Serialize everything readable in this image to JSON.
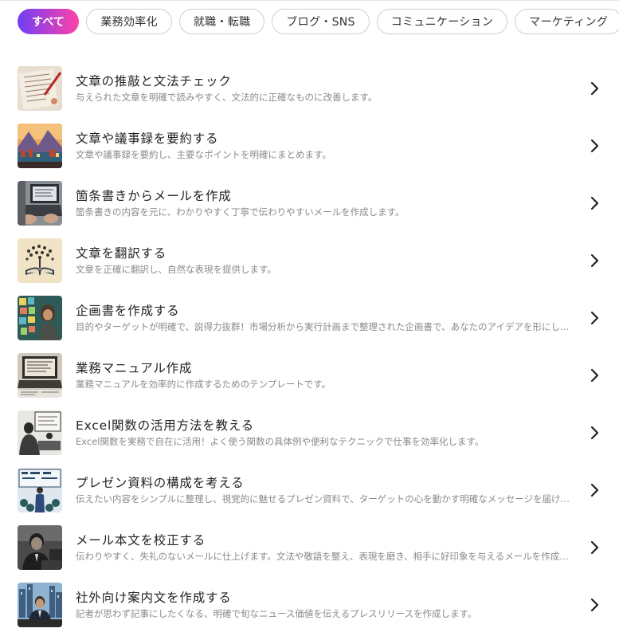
{
  "filters": [
    {
      "label": "すべて",
      "active": true
    },
    {
      "label": "業務効率化",
      "active": false
    },
    {
      "label": "就職・転職",
      "active": false
    },
    {
      "label": "ブログ・SNS",
      "active": false
    },
    {
      "label": "コミュニケーション",
      "active": false
    },
    {
      "label": "マーケティング",
      "active": false
    }
  ],
  "items": [
    {
      "title": "文章の推敲と文法チェック",
      "description": "与えられた文章を明確で読みやすく、文法的に正確なものに改善します。",
      "thumb": "pen-paper"
    },
    {
      "title": "文章や議事録を要約する",
      "description": "文章や議事録を要約し、主要なポイントを明確にまとめます。",
      "thumb": "landscape-town"
    },
    {
      "title": "箇条書きからメールを作成",
      "description": "箇条書きの内容を元に、わかりやすく丁寧で伝わりやすいメールを作成します。",
      "thumb": "laptop-hands"
    },
    {
      "title": "文章を翻訳する",
      "description": "文章を正確に翻訳し、自然な表現を提供します。",
      "thumb": "book-tree"
    },
    {
      "title": "企画書を作成する",
      "description": "目的やターゲットが明確で、説得力抜群！市場分析から実行計画まで整理された企画書で、あなたのアイデアを形にします。",
      "thumb": "notes-wall"
    },
    {
      "title": "業務マニュアル作成",
      "description": "業務マニュアルを効率的に作成するためのテンプレートです。",
      "thumb": "laptop-desk"
    },
    {
      "title": "Excel関数の活用方法を教える",
      "description": "Excel関数を実務で自在に活用！よく使う関数の具体例や便利なテクニックで仕事を効率化します。",
      "thumb": "classroom"
    },
    {
      "title": "プレゼン資料の構成を考える",
      "description": "伝えたい内容をシンプルに整理し、視覚的に魅せるプレゼン資料で、ターゲットの心を動かす明確なメッセージを届けます。",
      "thumb": "presentation"
    },
    {
      "title": "メール本文を校正する",
      "description": "伝わりやすく、失礼のないメールに仕上げます。文法や敬語を整え、表現を磨き、相手に好印象を与えるメールを作成します。",
      "thumb": "businessman"
    },
    {
      "title": "社外向け案内文を作成する",
      "description": "記者が思わず記事にしたくなる、明確で旬なニュース価値を伝えるプレスリリースを作成します。",
      "thumb": "city-office"
    }
  ]
}
